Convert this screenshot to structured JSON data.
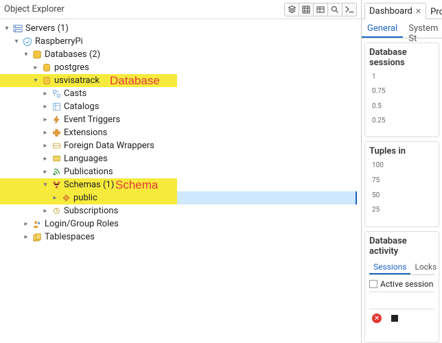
{
  "left_title": "Object Explorer",
  "annotations": {
    "database": "Database",
    "schema": "Schema"
  },
  "tree": {
    "servers": "Servers (1)",
    "server_name": "RaspberryPi",
    "databases": "Databases (2)",
    "db_postgres": "postgres",
    "db_usvisa": "usvisatrack",
    "casts": "Casts",
    "catalogs": "Catalogs",
    "event_triggers": "Event Triggers",
    "extensions": "Extensions",
    "fdw": "Foreign Data Wrappers",
    "languages": "Languages",
    "publications": "Publications",
    "schemas": "Schemas (1)",
    "public": "public",
    "subscriptions": "Subscriptions",
    "login_roles": "Login/Group Roles",
    "tablespaces": "Tablespaces"
  },
  "right": {
    "tab_dashboard": "Dashboard",
    "tab_properties": "Proper",
    "tab_general": "General",
    "tab_system": "System St",
    "sessions_title": "Database sessions",
    "tuples_title": "Tuples in",
    "activity_title": "Database activity",
    "tab_sessions": "Sessions",
    "tab_locks": "Locks",
    "active_label": "Active session"
  },
  "chart_data": [
    {
      "type": "line",
      "title": "Database sessions",
      "ylim": [
        0,
        1
      ],
      "yticks": [
        1,
        0.75,
        0.5,
        0.25
      ],
      "series": [
        {
          "name": "sessions",
          "values": []
        }
      ]
    },
    {
      "type": "line",
      "title": "Tuples in",
      "ylim": [
        0,
        100
      ],
      "yticks": [
        100,
        75,
        50,
        25
      ],
      "series": [
        {
          "name": "tuples_in",
          "values": []
        }
      ]
    }
  ]
}
